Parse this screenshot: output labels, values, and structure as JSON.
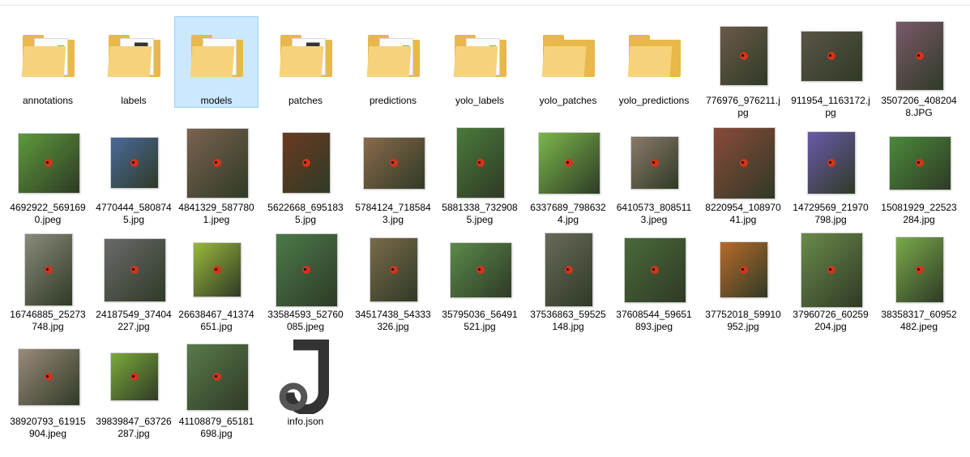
{
  "folders": [
    {
      "name": "annotations",
      "icon": "folder-icon",
      "variant": "docs"
    },
    {
      "name": "labels",
      "icon": "folder-icon",
      "variant": "json"
    },
    {
      "name": "models",
      "icon": "folder-icon",
      "variant": "plain-docs",
      "selected": true
    },
    {
      "name": "patches",
      "icon": "folder-icon",
      "variant": "json"
    },
    {
      "name": "predictions",
      "icon": "folder-icon",
      "variant": "docs"
    },
    {
      "name": "yolo_labels",
      "icon": "folder-icon",
      "variant": "docs"
    },
    {
      "name": "yolo_patches",
      "icon": "folder-icon",
      "variant": "empty"
    },
    {
      "name": "yolo_predictions",
      "icon": "folder-icon",
      "variant": "empty"
    }
  ],
  "files": [
    {
      "name": "776976_976211.jpg",
      "icon": "photo-thumbnail-icon",
      "color": "#6b5a4a"
    },
    {
      "name": "911954_1163172.jpg",
      "icon": "photo-thumbnail-icon",
      "color": "#5a5545"
    },
    {
      "name": "3507206_4082048.JPG",
      "icon": "photo-thumbnail-icon",
      "color": "#7a5a6a"
    },
    {
      "name": "4692922_5691690.jpeg",
      "icon": "photo-thumbnail-icon",
      "color": "#5c9a3a"
    },
    {
      "name": "4770444_5808745.jpg",
      "icon": "photo-thumbnail-icon",
      "color": "#4a6a9a"
    },
    {
      "name": "4841329_5877801.jpeg",
      "icon": "photo-thumbnail-icon",
      "color": "#7a6250"
    },
    {
      "name": "5622668_6951835.jpg",
      "icon": "photo-thumbnail-icon",
      "color": "#6a3a20"
    },
    {
      "name": "5784124_7185843.jpg",
      "icon": "photo-thumbnail-icon",
      "color": "#8a6a4a"
    },
    {
      "name": "5881338_7329085.jpeg",
      "icon": "photo-thumbnail-icon",
      "color": "#4a7a3a"
    },
    {
      "name": "6337689_7986324.jpg",
      "icon": "photo-thumbnail-icon",
      "color": "#7ab84a"
    },
    {
      "name": "6410573_8085113.jpeg",
      "icon": "photo-thumbnail-icon",
      "color": "#8a7a6a"
    },
    {
      "name": "8220954_10897041.jpg",
      "icon": "photo-thumbnail-icon",
      "color": "#8a4a3a"
    },
    {
      "name": "14729569_21970798.jpg",
      "icon": "photo-thumbnail-icon",
      "color": "#6a5aaa"
    },
    {
      "name": "15081929_22523284.jpg",
      "icon": "photo-thumbnail-icon",
      "color": "#4a8a3a"
    },
    {
      "name": "16746885_25273748.jpg",
      "icon": "photo-thumbnail-icon",
      "color": "#8a8a7a"
    },
    {
      "name": "24187549_37404227.jpg",
      "icon": "photo-thumbnail-icon",
      "color": "#6a6a6a"
    },
    {
      "name": "26638467_41374651.jpg",
      "icon": "photo-thumbnail-icon",
      "color": "#9ab83a"
    },
    {
      "name": "33584593_52760085.jpeg",
      "icon": "photo-thumbnail-icon",
      "color": "#4a7a4a"
    },
    {
      "name": "34517438_54333326.jpg",
      "icon": "photo-thumbnail-icon",
      "color": "#7a6a4a"
    },
    {
      "name": "35795036_56491521.jpg",
      "icon": "photo-thumbnail-icon",
      "color": "#5a8a4a"
    },
    {
      "name": "37536863_59525148.jpg",
      "icon": "photo-thumbnail-icon",
      "color": "#6a6a5a"
    },
    {
      "name": "37608544_59651893.jpeg",
      "icon": "photo-thumbnail-icon",
      "color": "#4a6a3a"
    },
    {
      "name": "37752018_59910952.jpg",
      "icon": "photo-thumbnail-icon",
      "color": "#b86a2a"
    },
    {
      "name": "37960726_60259204.jpg",
      "icon": "photo-thumbnail-icon",
      "color": "#6a8a4a"
    },
    {
      "name": "38358317_60952482.jpeg",
      "icon": "photo-thumbnail-icon",
      "color": "#7aaa4a"
    },
    {
      "name": "38920793_61915904.jpeg",
      "icon": "photo-thumbnail-icon",
      "color": "#9a8a7a"
    },
    {
      "name": "39839847_63726287.jpg",
      "icon": "photo-thumbnail-icon",
      "color": "#7aaa3a"
    },
    {
      "name": "41108879_65181698.jpg",
      "icon": "photo-thumbnail-icon",
      "color": "#5a7a4a"
    },
    {
      "name": "info.json",
      "icon": "json-file-icon",
      "color": "#333333"
    }
  ]
}
